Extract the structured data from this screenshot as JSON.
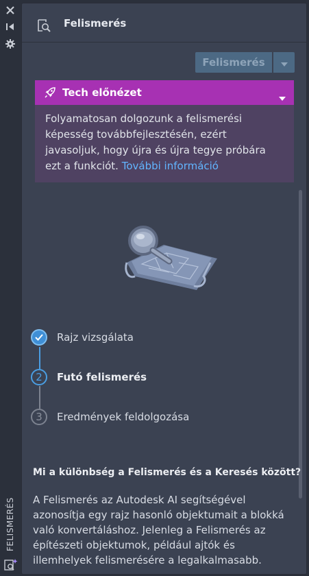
{
  "sidebar": {
    "vertical_label": "FELISMERÉS",
    "icons": [
      "close-icon",
      "collapse-icon",
      "settings-icon",
      "recognition-icon"
    ]
  },
  "header": {
    "title": "Felismerés",
    "icon": "recognition-icon"
  },
  "action": {
    "button_label": "Felismerés",
    "dropdown_icon": "caret-down-icon"
  },
  "tech_preview": {
    "title": "Tech előnézet",
    "icon": "rocket-icon",
    "text": "Folyamatosan dolgozunk a felismerési képesség továbbfejlesztésén, ezért javasoljuk, hogy újra és újra tegye próbára ezt a funkciót.",
    "link_text": "További információ",
    "colors": {
      "bar": "#a731b3",
      "body": "#4f4262",
      "link": "#62b5ff"
    }
  },
  "steps": [
    {
      "number": "1",
      "label": "Rajz vizsgálata",
      "state": "done"
    },
    {
      "number": "2",
      "label": "Futó felismerés",
      "state": "active"
    },
    {
      "number": "3",
      "label": "Eredmények feldolgozása",
      "state": "pending"
    }
  ],
  "faq": {
    "question": "Mi a különbség a Felismerés és a Keresés között?",
    "answer": "A Felismerés az Autodesk AI segítségével azonosítja egy rajz hasonló objektumait a blokká való konvertáláshoz. Jelenleg a Felismerés az építészeti objektumok, például ajtók és illemhelyek felismerésére a legalkalmasabb."
  }
}
